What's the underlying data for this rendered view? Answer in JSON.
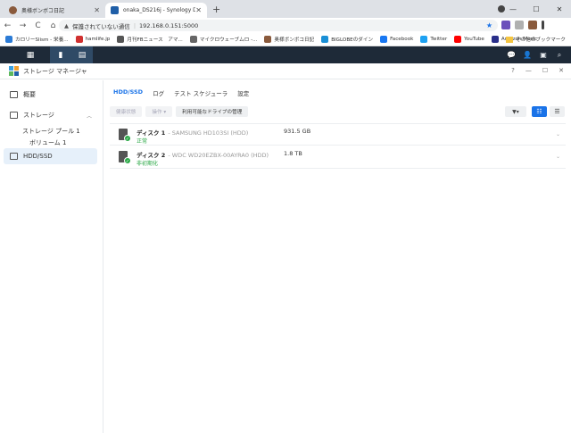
{
  "browser": {
    "tabs": [
      {
        "title": "奥様ボンボコ日記",
        "favicon_color": "#8a5a3c",
        "active": false
      },
      {
        "title": "onaka_DS216j - Synology DiskSt",
        "favicon_color": "#1f5fa8",
        "active": true
      }
    ],
    "new_tab": "+",
    "window_controls": [
      "—",
      "☐",
      "✕"
    ],
    "nav": {
      "back": "←",
      "forward": "→",
      "reload": "C",
      "home": "⌂"
    },
    "address": {
      "security_label": "保護されていない通信",
      "url": "192.168.0.151:5000",
      "warn_glyph": "▲",
      "star_glyph": "★"
    },
    "bookmarks": [
      {
        "label": "カロリーSlism - 栄養...",
        "color": "#2b7bd6"
      },
      {
        "label": "hamlife.jp",
        "color": "#d0302f"
      },
      {
        "label": "月刊FBニュース　アマ...",
        "color": "#555555"
      },
      {
        "label": "マイクロウェーブムロ -...",
        "color": "#666666"
      },
      {
        "label": "奥様ボンボコ日記",
        "color": "#8a5a3c"
      },
      {
        "label": "BIGLOBEのダイン",
        "color": "#1a8fd6"
      },
      {
        "label": "Facebook",
        "color": "#1877f2"
      },
      {
        "label": "Twitter",
        "color": "#1da1f2"
      },
      {
        "label": "YouTube",
        "color": "#ff0000"
      },
      {
        "label": "Amazon Music",
        "color": "#2a2f8a"
      }
    ],
    "other_bookmarks": "その他のブックマーク",
    "extensions": [
      "#6b4fbb",
      "#b0b0b0",
      "#8a5a3c",
      "#444444"
    ]
  },
  "dsm": {
    "taskbar_left": [
      "▦",
      "▮",
      "▤"
    ],
    "taskbar_right": [
      "💬",
      "👤",
      "▣",
      "⌕"
    ]
  },
  "window": {
    "title": "ストレージ マネージャ",
    "actions": [
      "?",
      "—",
      "☐",
      "✕"
    ]
  },
  "sidebar": {
    "overview": "概要",
    "storage": "ストレージ",
    "storage_pool": "ストレージ プール 1",
    "volume": "ボリューム 1",
    "hdd": "HDD/SSD"
  },
  "main": {
    "tabs": [
      {
        "label": "HDD/SSD",
        "active": true
      },
      {
        "label": "ログ",
        "active": false
      },
      {
        "label": "テスト スケジューラ",
        "active": false
      },
      {
        "label": "設定",
        "active": false
      }
    ],
    "buttons": {
      "health": "健康状態",
      "action": "操作 ▾",
      "manage": "利用可能なドライブの管理",
      "filter": "▼▾",
      "list_view": "☷",
      "grid_view": "☰"
    },
    "disks": [
      {
        "name": "ディスク 1",
        "model": "- SAMSUNG HD103SI (HDD)",
        "status": "正常",
        "size": "931.5 GB"
      },
      {
        "name": "ディスク 2",
        "model": "- WDC WD20EZBX-00AYRA0 (HDD)",
        "status": "非初期化",
        "size": "1.8 TB"
      }
    ],
    "row_chevron": "⌄",
    "ok_glyph": "✓"
  }
}
